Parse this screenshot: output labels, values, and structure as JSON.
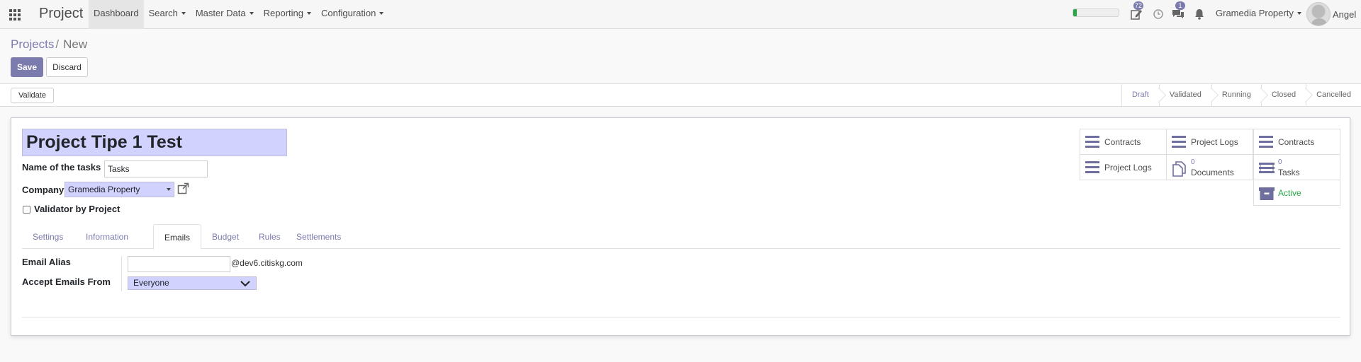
{
  "app": {
    "title": "Project"
  },
  "navbar": {
    "menu": [
      {
        "label": "Dashboard",
        "active": true,
        "dropdown": false
      },
      {
        "label": "Search",
        "active": false,
        "dropdown": true
      },
      {
        "label": "Master Data",
        "active": false,
        "dropdown": true
      },
      {
        "label": "Reporting",
        "active": false,
        "dropdown": true
      },
      {
        "label": "Configuration",
        "active": false,
        "dropdown": true
      }
    ],
    "systray": {
      "progress_fraction": 0.08,
      "activities_badge": "72",
      "messages_badge": "1",
      "company": "Gramedia Property",
      "user": "Angel"
    }
  },
  "breadcrumb": {
    "parent": "Projects",
    "separator": "/",
    "current": "New"
  },
  "buttons": {
    "save": "Save",
    "discard": "Discard",
    "validate": "Validate"
  },
  "statusbar": {
    "stages": [
      "Draft",
      "Validated",
      "Running",
      "Closed",
      "Cancelled"
    ],
    "current": "Draft"
  },
  "form": {
    "name": "Project Tipe 1 Test",
    "tasks_label": "Name of the tasks :",
    "tasks_value": "Tasks",
    "company_label": "Company",
    "company_value": "Gramedia Property",
    "validator_label": "Validator by Project",
    "validator_checked": false
  },
  "button_box": {
    "contracts_1": "Contracts",
    "project_logs_1": "Project Logs",
    "contracts_2": "Contracts",
    "project_logs_2": "Project Logs",
    "documents_count": "0",
    "documents_label": "Documents",
    "tasks_count": "0",
    "tasks_label": "Tasks",
    "active_label": "Active"
  },
  "tabs": [
    {
      "label": "Settings",
      "active": false
    },
    {
      "label": "Information",
      "active": false
    },
    {
      "label": "Emails",
      "active": true
    },
    {
      "label": "Budget",
      "active": false
    },
    {
      "label": "Rules",
      "active": false
    },
    {
      "label": "Settlements",
      "active": false
    }
  ],
  "emails_tab": {
    "alias_label": "Email Alias",
    "alias_value": "",
    "alias_domain": "@dev6.citiskg.com",
    "accept_label": "Accept Emails From",
    "accept_value": "Everyone"
  },
  "colors": {
    "accent": "#7c7bad",
    "required_field": "#d2d2ff",
    "active_green": "#28a745"
  }
}
